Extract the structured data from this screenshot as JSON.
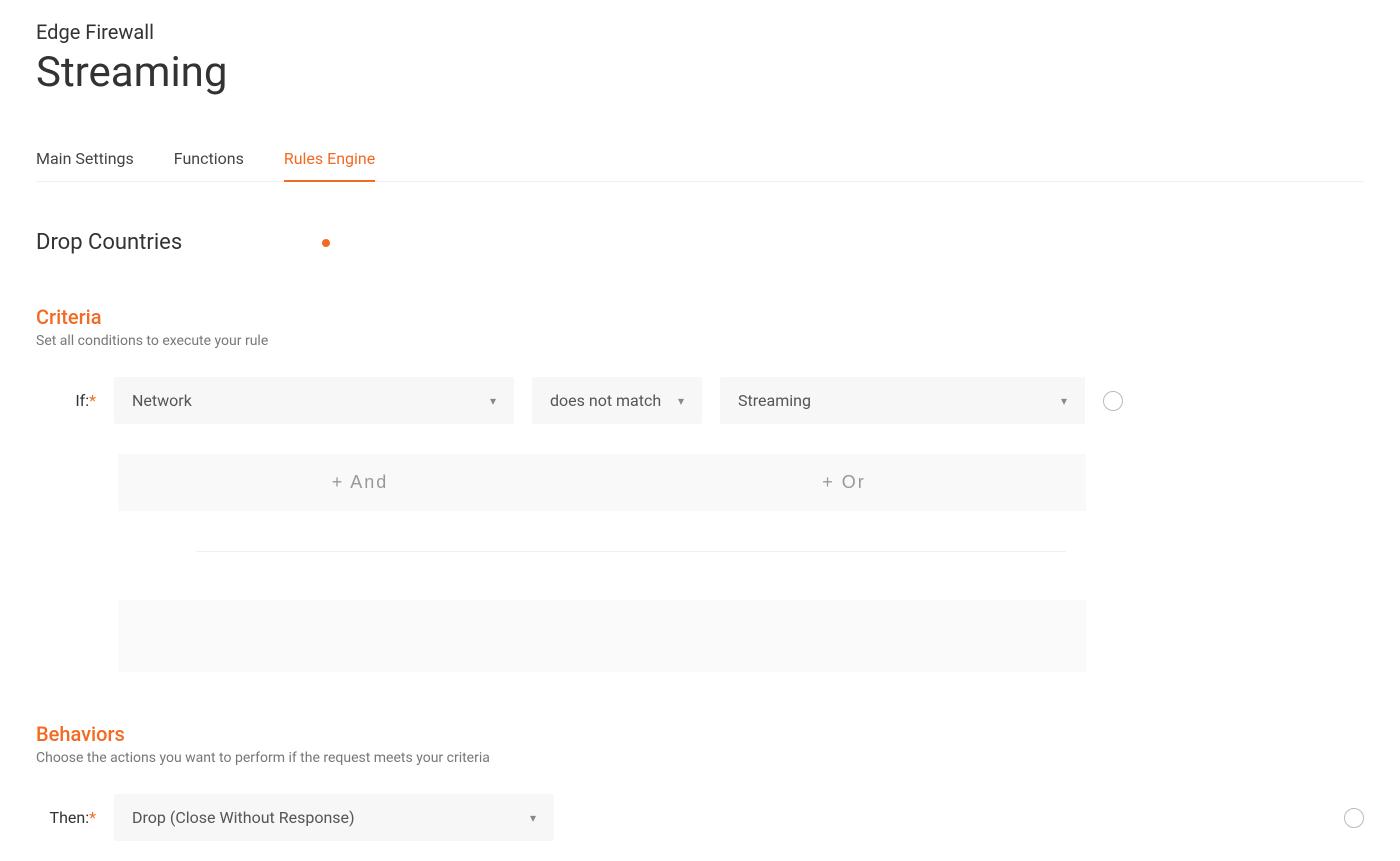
{
  "breadcrumb": "Edge Firewall",
  "page_title": "Streaming",
  "tabs": {
    "main_settings": "Main Settings",
    "functions": "Functions",
    "rules_engine": "Rules Engine"
  },
  "rule_name": "Drop Countries",
  "criteria": {
    "title": "Criteria",
    "description": "Set all conditions to execute your rule",
    "if_label": "If:",
    "variable": "Network",
    "operator": "does not match",
    "value": "Streaming",
    "and_label": "+ And",
    "or_label": "+ Or"
  },
  "behaviors": {
    "title": "Behaviors",
    "description": "Choose the actions you want to perform if the request meets your criteria",
    "then_label": "Then:",
    "action": "Drop (Close Without Response)"
  }
}
